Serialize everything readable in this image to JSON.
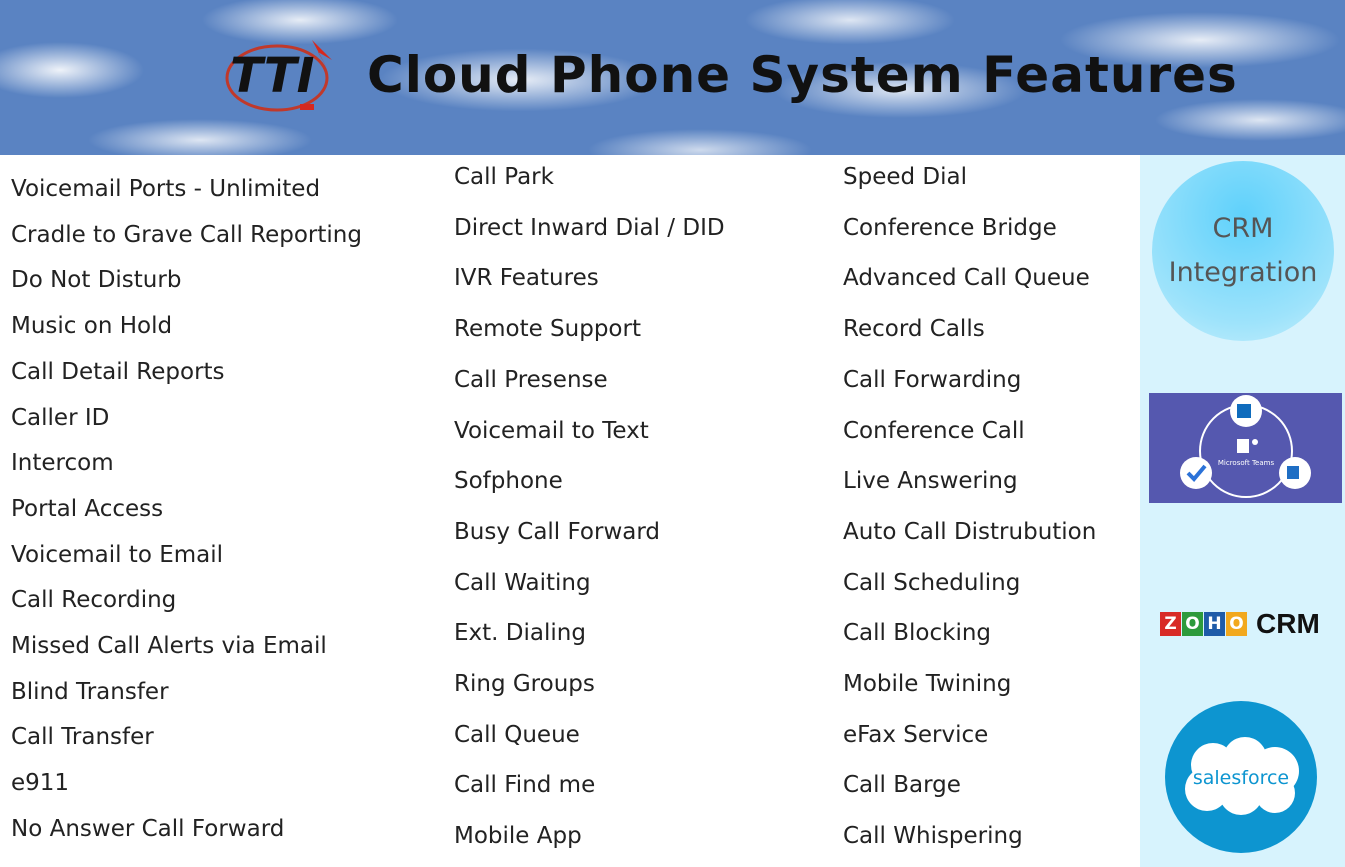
{
  "header": {
    "logo_text": "TTI",
    "title": "Cloud Phone System Features"
  },
  "features": {
    "column1": [
      "Voicemail Ports - Unlimited",
      "Cradle to Grave Call Reporting",
      "Do Not Disturb",
      "Music on Hold",
      "Call Detail Reports",
      "Caller ID",
      "Intercom",
      "Portal Access",
      "Voicemail to Email",
      "Call Recording",
      "Missed Call Alerts via Email",
      "Blind Transfer",
      "Call Transfer",
      "e911",
      "No Answer Call Forward"
    ],
    "column2": [
      "Call Park",
      "Direct Inward Dial / DID",
      "IVR Features",
      "Remote Support",
      "Call Presense",
      "Voicemail to Text",
      "Sofphone",
      "Busy Call Forward",
      "Call Waiting",
      "Ext. Dialing",
      "Ring Groups",
      "Call Queue",
      "Call Find me",
      "Mobile App"
    ],
    "column3": [
      "Speed Dial",
      "Conference Bridge",
      "Advanced Call Queue",
      "Record Calls",
      "Call Forwarding",
      "Conference Call",
      "Live Answering",
      "Auto Call Distrubution",
      "Call Scheduling",
      "Call Blocking",
      "Mobile Twining",
      " eFax Service",
      "Call Barge",
      "Call Whispering"
    ]
  },
  "sidebar": {
    "crm_line1": "CRM",
    "crm_line2": "Integration",
    "teams_label": "Microsoft Teams",
    "zoho_letters": [
      "Z",
      "O",
      "H",
      "O"
    ],
    "zoho_colors": [
      "#d82a26",
      "#2d9a3c",
      "#1e5ba8",
      "#f2a81d"
    ],
    "zoho_suffix": "CRM",
    "salesforce": "salesforce"
  },
  "colors": {
    "sky": "#5a83c2",
    "sidebar_bg": "#d7f3fd",
    "teams_bg": "#5558af",
    "salesforce": "#0d95d0"
  }
}
